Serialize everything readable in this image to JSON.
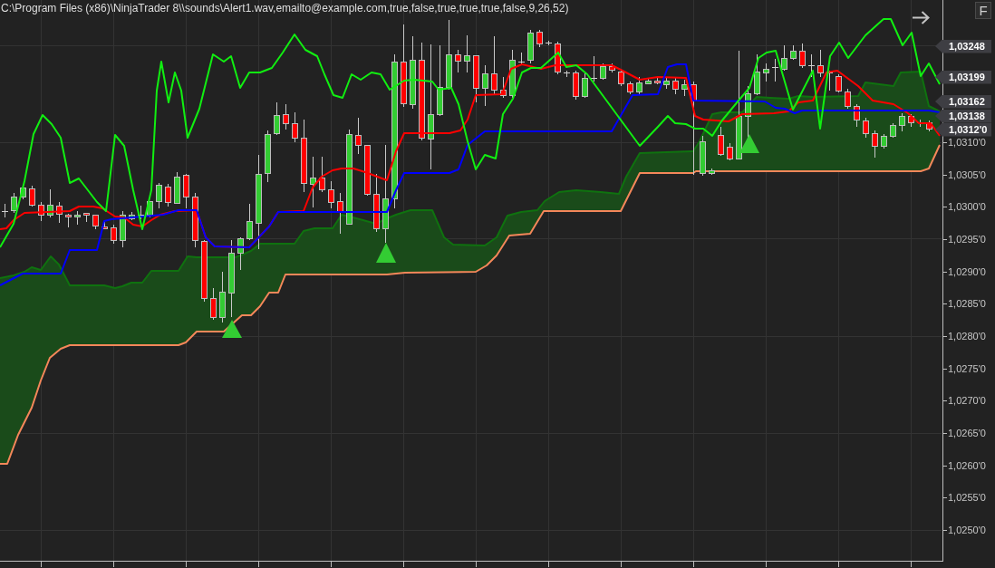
{
  "title": "C:\\Program Files (x86)\\NinjaTrader 8\\\\sounds\\Alert1.wav,emailto@example.com,true,false,true,true,true,false,9,26,52)",
  "toolbar": {
    "f_button": "F"
  },
  "price_axis": {
    "labels": [
      "1,0310'0",
      "1,0305'0",
      "1,0300'0",
      "1,0295'0",
      "1,0290'0",
      "1,0285'0",
      "1,0280'0",
      "1,0275'0",
      "1,0270'0",
      "1,0265'0",
      "1,0260'0",
      "1,0255'0",
      "1,0250'0"
    ]
  },
  "price_markers": [
    "1,03248",
    "1,03199",
    "1,03162",
    "1,03138",
    "1,0312'0"
  ]
}
